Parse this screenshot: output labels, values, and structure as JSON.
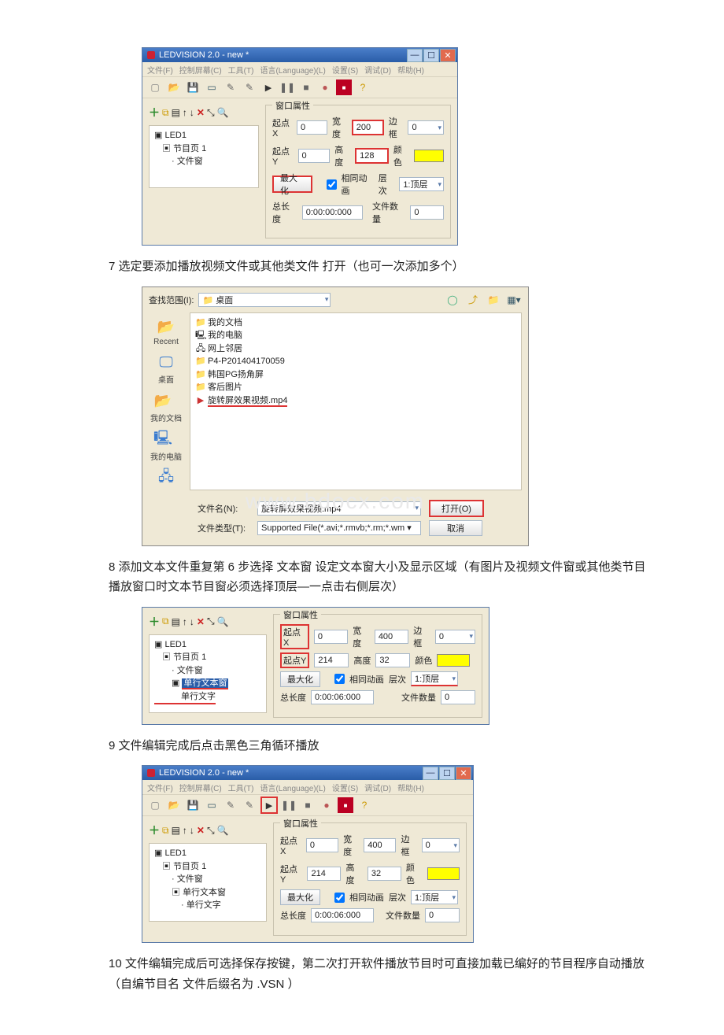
{
  "app_title": "LEDVISION 2.0 - new *",
  "menus": [
    "文件(F)",
    "控制屏幕(C)",
    "工具(T)",
    "语言(Language)(L)",
    "设置(S)",
    "调试(D)",
    "帮助(H)"
  ],
  "window_props_label": "窗口属性",
  "labels": {
    "startX": "起点X",
    "startY": "起点Y",
    "width": "宽度",
    "height": "高度",
    "border": "边框",
    "color": "颜色",
    "maximize": "最大化",
    "sameframe": "相同动画",
    "layer": "层次",
    "duration": "总长度",
    "filecount": "文件数量"
  },
  "screens": {
    "a": {
      "tree": [
        "LED1",
        "节目页 1",
        "文件窗"
      ],
      "startX": "0",
      "startY": "0",
      "width": "200",
      "height": "128",
      "border": "0",
      "layer": "1:顶层",
      "duration": "0:00:00:000",
      "filecount": "0"
    },
    "b": {
      "tree": [
        "LED1",
        "节目页 1",
        "文件窗",
        "单行文本窗",
        "单行文字"
      ],
      "startX": "0",
      "startY": "214",
      "width": "400",
      "height": "32",
      "border": "0",
      "layer": "1:顶层",
      "duration": "0:00:06:000",
      "filecount": "0"
    },
    "c": {
      "tree": [
        "LED1",
        "节目页 1",
        "文件窗",
        "单行文本窗",
        "单行文字"
      ],
      "startX": "0",
      "startY": "214",
      "width": "400",
      "height": "32",
      "border": "0",
      "layer": "1:顶层",
      "duration": "0:00:06:000",
      "filecount": "0"
    }
  },
  "filedlg": {
    "scope_label": "查找范围(I):",
    "scope_value": "桌面",
    "side": [
      "Recent",
      "桌面",
      "我的文档",
      "我的电脑"
    ],
    "items": [
      "我的文档",
      "我的电脑",
      "网上邻居",
      "P4-P201404170059",
      "韩国PG扬角屏",
      "客后图片",
      "旋转屏效果视频.mp4"
    ],
    "filename_label": "文件名(N):",
    "filename_value": "旋转屏效果视频.mp4",
    "filetype_label": "文件类型(T):",
    "filetype_value": "Supported File(*.avi;*.rmvb;*.rm;*.wm ▾",
    "open": "打开(O)",
    "cancel": "取消"
  },
  "paras": {
    "p7": "7 选定要添加播放视频文件或其他类文件 打开（也可一次添加多个）",
    "p8": "8 添加文本文件重复第 6 步选择 文本窗 设定文本窗大小及显示区域（有图片及视频文件窗或其他类节目播放窗口时文本节目窗必须选择顶层—一点击右侧层次）",
    "p9": "9 文件编辑完成后点击黑色三角循环播放",
    "p10": "10 文件编辑完成后可选择保存按键，第二次打开软件播放节目时可直接加载已编好的节目程序自动播放 （自编节目名 文件后缀名为 .VSN ）"
  },
  "watermark": "www.bdocx.com"
}
